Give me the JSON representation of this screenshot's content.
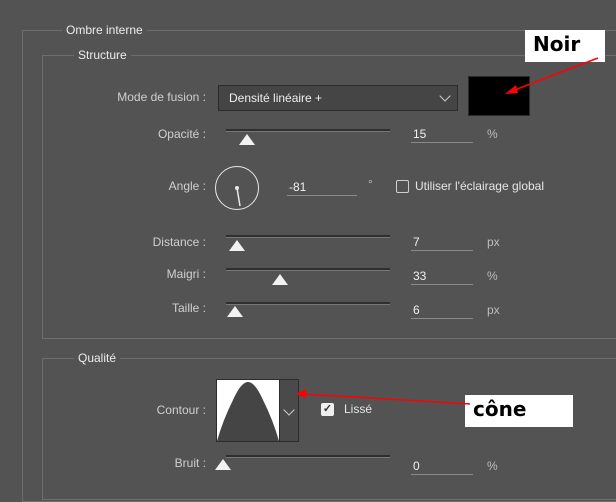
{
  "panel": {
    "title": "Ombre interne",
    "structure": {
      "title": "Structure",
      "blend_mode": {
        "label": "Mode de fusion :",
        "value": "Densité linéaire +",
        "swatch_color": "#000000"
      },
      "opacity": {
        "label": "Opacité :",
        "value": "15",
        "unit": "%",
        "level": 0.15
      },
      "angle": {
        "label": "Angle :",
        "value": "-81",
        "unit": "°",
        "global_light_label": "Utiliser l'éclairage global",
        "global_light_checked": false
      },
      "distance": {
        "label": "Distance :",
        "value": "7",
        "unit": "px",
        "level": 0.05
      },
      "choke": {
        "label": "Maigri :",
        "value": "33",
        "unit": "%",
        "level": 0.33
      },
      "size": {
        "label": "Taille :",
        "value": "6",
        "unit": "px",
        "level": 0.04
      }
    },
    "quality": {
      "title": "Qualité",
      "contour": {
        "label": "Contour :",
        "smooth_label": "Lissé",
        "smooth_checked": true
      },
      "noise": {
        "label": "Bruit :",
        "value": "0",
        "unit": "%",
        "level": 0.0
      }
    }
  },
  "annotations": {
    "noir": {
      "text": "Noir",
      "color": "#ff0000"
    },
    "cone": {
      "text": "cône",
      "color": "#ff0000"
    }
  }
}
